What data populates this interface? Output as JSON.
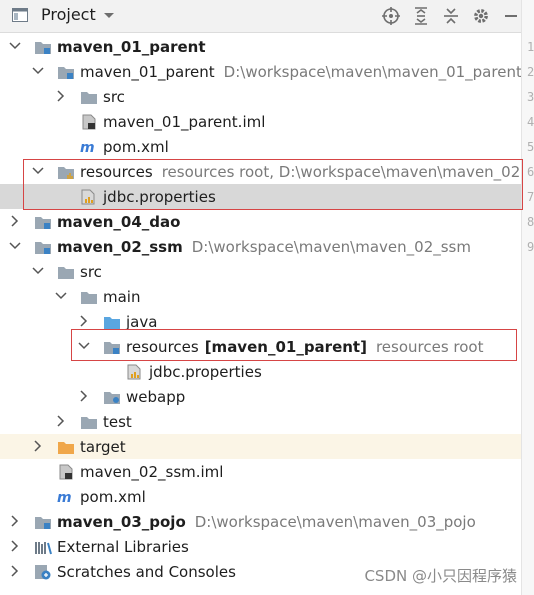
{
  "header": {
    "title": "Project"
  },
  "gutter": {
    "numbers": [
      "1",
      "2",
      "3",
      "4",
      "5",
      "6",
      "7",
      "8",
      "9"
    ]
  },
  "tree": {
    "rows": [
      {
        "name": "maven_01_parent",
        "bold": true,
        "path": ""
      },
      {
        "name": "maven_01_parent",
        "bold": false,
        "path": "D:\\workspace\\maven\\maven_01_parent"
      },
      {
        "name": "src",
        "bold": false,
        "path": ""
      },
      {
        "name": "maven_01_parent.iml",
        "bold": false,
        "path": ""
      },
      {
        "name": "pom.xml",
        "bold": false,
        "path": ""
      },
      {
        "name": "resources",
        "bold": false,
        "path": "resources root,  D:\\workspace\\maven\\maven_02"
      },
      {
        "name": "jdbc.properties",
        "bold": false,
        "path": ""
      },
      {
        "name": "maven_04_dao",
        "bold": true,
        "path": ""
      },
      {
        "name": "maven_02_ssm",
        "bold": true,
        "path": "D:\\workspace\\maven\\maven_02_ssm"
      },
      {
        "name": "src",
        "bold": false,
        "path": ""
      },
      {
        "name": "main",
        "bold": false,
        "path": ""
      },
      {
        "name": "java",
        "bold": false,
        "path": ""
      },
      {
        "name": "resources",
        "bold": false,
        "module": "[maven_01_parent]",
        "path": "resources root"
      },
      {
        "name": "jdbc.properties",
        "bold": false,
        "path": ""
      },
      {
        "name": "webapp",
        "bold": false,
        "path": ""
      },
      {
        "name": "test",
        "bold": false,
        "path": ""
      },
      {
        "name": "target",
        "bold": false,
        "path": ""
      },
      {
        "name": "maven_02_ssm.iml",
        "bold": false,
        "path": ""
      },
      {
        "name": "pom.xml",
        "bold": false,
        "path": ""
      },
      {
        "name": "maven_03_pojo",
        "bold": true,
        "path": "D:\\workspace\\maven\\maven_03_pojo"
      },
      {
        "name": "External Libraries",
        "bold": false,
        "path": ""
      },
      {
        "name": "Scratches and Consoles",
        "bold": false,
        "path": ""
      }
    ]
  },
  "watermark": "CSDN @小只因程序猿",
  "colors": {
    "selection": "#d8d8d8",
    "highlight_box": "#d64545",
    "folder": "#9aa7b3",
    "module": "#3b82c4"
  }
}
